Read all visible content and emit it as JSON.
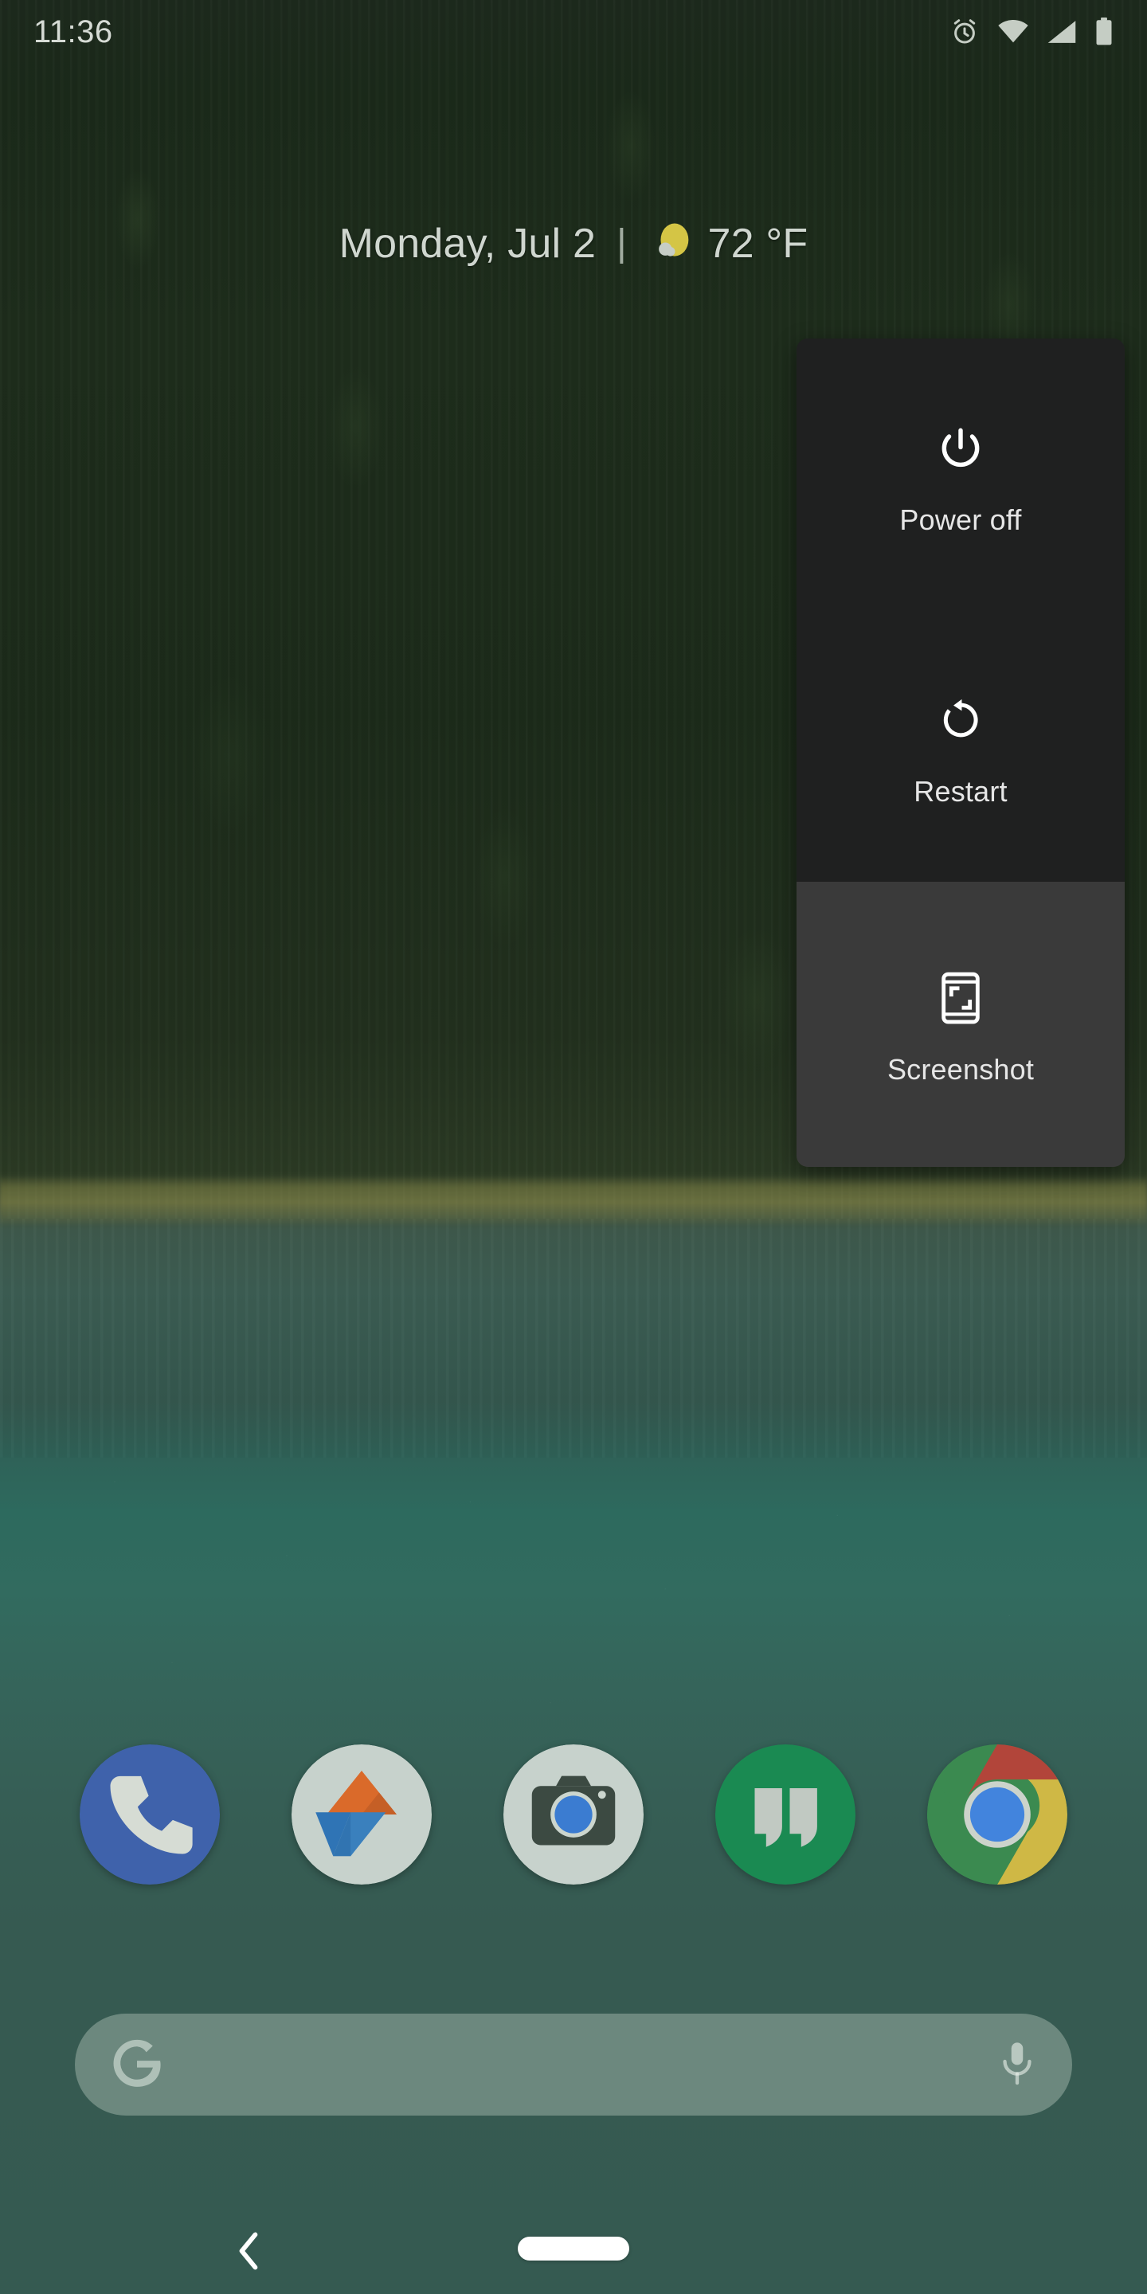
{
  "status_bar": {
    "clock": "11:36",
    "icons": [
      {
        "name": "alarm-icon",
        "label": "alarm"
      },
      {
        "name": "wifi-icon",
        "label": "wifi"
      },
      {
        "name": "cellular-signal-icon",
        "label": "signal"
      },
      {
        "name": "battery-icon",
        "label": "battery"
      }
    ]
  },
  "widget": {
    "date": "Monday, Jul 2",
    "separator": "|",
    "temperature": "72 °F",
    "weather_icon": "partly-sunny-icon"
  },
  "power_menu": {
    "background_top": "#1f2020",
    "background_highlight": "#3a3a3a",
    "items": [
      {
        "label": "Power off",
        "icon": "power-icon",
        "highlighted": false
      },
      {
        "label": "Restart",
        "icon": "restart-icon",
        "highlighted": false
      },
      {
        "label": "Screenshot",
        "icon": "screenshot-icon",
        "highlighted": true
      }
    ]
  },
  "dock": {
    "apps": [
      {
        "name": "phone",
        "label": "Phone",
        "color": "#3f62ab"
      },
      {
        "name": "drive",
        "label": "Drive",
        "color": "#c7d2cc"
      },
      {
        "name": "camera",
        "label": "Camera",
        "color": "#c7d2cc"
      },
      {
        "name": "hangouts",
        "label": "Hangouts",
        "color": "#1a8a52"
      },
      {
        "name": "chrome",
        "label": "Chrome",
        "color": "#c3412f"
      }
    ]
  },
  "search": {
    "value": "",
    "placeholder": "",
    "logo": "google-g-icon",
    "mic": "microphone-icon"
  },
  "nav_bar": {
    "back": "back-chevron-icon",
    "home": "home-pill"
  }
}
